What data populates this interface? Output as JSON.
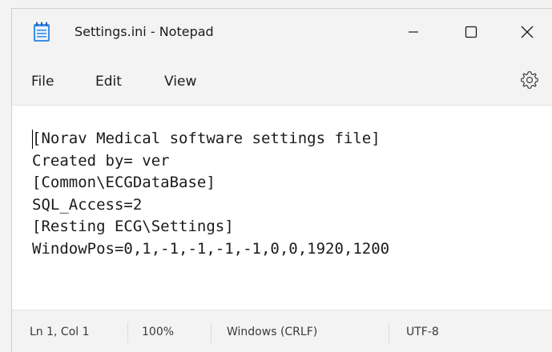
{
  "window": {
    "title": "Settings.ini - Notepad",
    "app_icon": "notepad-icon",
    "controls": {
      "minimize": "minimize-icon",
      "maximize": "maximize-icon",
      "close": "close-icon"
    }
  },
  "menubar": {
    "items": [
      {
        "label": "File"
      },
      {
        "label": "Edit"
      },
      {
        "label": "View"
      }
    ],
    "settings_icon": "gear-icon"
  },
  "editor": {
    "content": "[Norav Medical software settings file]\nCreated by= ver\n[Common\\ECGDataBase]\nSQL_Access=2\n[Resting ECG\\Settings]\nWindowPos=0,1,-1,-1,-1,-1,0,0,1920,1200"
  },
  "statusbar": {
    "position": "Ln 1, Col 1",
    "zoom": "100%",
    "line_ending": "Windows (CRLF)",
    "encoding": "UTF-8"
  },
  "colors": {
    "titlebar_bg": "#f3f3f3",
    "editor_bg": "#ffffff",
    "icon_accent": "#2d7fd6"
  }
}
